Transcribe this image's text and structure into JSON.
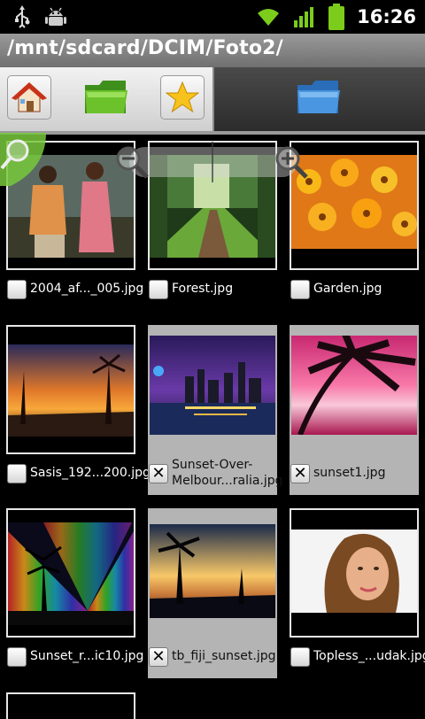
{
  "status_bar": {
    "time": "16:26",
    "left_icons": [
      "usb-icon",
      "android-debug-icon"
    ],
    "right_icons": [
      "wifi-icon",
      "signal-icon",
      "battery-icon"
    ]
  },
  "path": "/mnt/sdcard/DCIM/Foto2/",
  "toolbar": {
    "buttons": [
      "home-icon",
      "folder-green-icon",
      "star-icon",
      "folder-blue-icon"
    ]
  },
  "files": [
    {
      "name": "2004_af..._005.jpg",
      "selected": false
    },
    {
      "name": "Forest.jpg",
      "selected": false
    },
    {
      "name": "Garden.jpg",
      "selected": false
    },
    {
      "name": "Sasis_192...200.jpg",
      "selected": false
    },
    {
      "name": "Sunset-Over-Melbour...ralia.jpg",
      "selected": true
    },
    {
      "name": "sunset1.jpg",
      "selected": true
    },
    {
      "name": "Sunset_r...ic10.jpg",
      "selected": false
    },
    {
      "name": "tb_fiji_sunset.jpg",
      "selected": true
    },
    {
      "name": "Topless_...udak.jpg",
      "selected": false
    }
  ],
  "colors": {
    "selected_bg": "#b4b4b4",
    "wifi": "#7ccc1c",
    "battery": "#7ccc1c"
  }
}
